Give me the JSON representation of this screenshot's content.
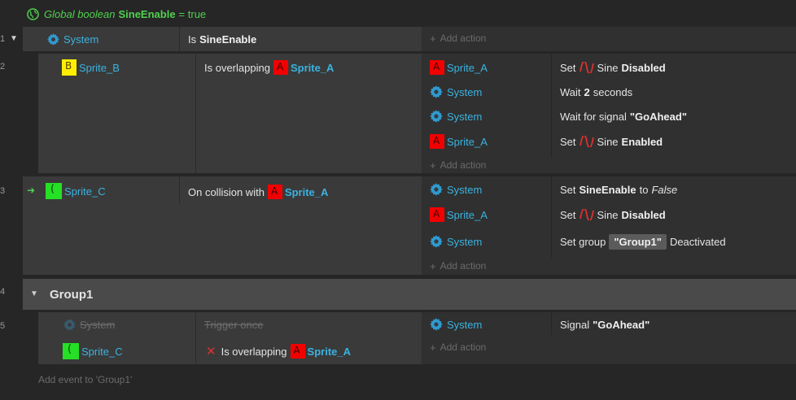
{
  "global_var": {
    "prefix": "Global boolean",
    "name": "SineEnable",
    "suffix": "= true"
  },
  "row_numbers": [
    "1",
    "2",
    "3",
    "4",
    "5"
  ],
  "event1": {
    "condition_object": "System",
    "condition_text_prefix": "Is",
    "condition_var": "SineEnable",
    "add_action": "Add action"
  },
  "event2": {
    "condition_object": "Sprite_B",
    "condition_text": "Is overlapping",
    "condition_target": "Sprite_A",
    "actions": [
      {
        "object": "Sprite_A",
        "verb": "Set",
        "behavior": "Sine",
        "state": "Disabled"
      },
      {
        "object": "System",
        "prefix": "Wait",
        "value": "2",
        "suffix": "seconds"
      },
      {
        "object": "System",
        "prefix": "Wait for signal",
        "value": "\"GoAhead\""
      },
      {
        "object": "Sprite_A",
        "verb": "Set",
        "behavior": "Sine",
        "state": "Enabled"
      }
    ],
    "add_action": "Add action"
  },
  "event3": {
    "trigger_arrow": "➜",
    "condition_object": "Sprite_C",
    "condition_text": "On collision with",
    "condition_target": "Sprite_A",
    "actions": [
      {
        "object": "System",
        "verb": "Set",
        "var": "SineEnable",
        "to": "to",
        "value": "False"
      },
      {
        "object": "Sprite_A",
        "verb": "Set",
        "behavior": "Sine",
        "state": "Disabled"
      },
      {
        "object": "System",
        "prefix": "Set group",
        "group": "\"Group1\"",
        "suffix": "Deactivated"
      }
    ],
    "add_action": "Add action"
  },
  "group": {
    "name": "Group1"
  },
  "event5": {
    "condition1_object": "System",
    "condition1_text": "Trigger once",
    "condition2_object": "Sprite_C",
    "condition2_invert": "✕",
    "condition2_text": "Is overlapping",
    "condition2_target": "Sprite_A",
    "actions": [
      {
        "object": "System",
        "prefix": "Signal",
        "value": "\"GoAhead\""
      }
    ],
    "add_action": "Add action"
  },
  "add_event": "Add event to 'Group1'",
  "colors": {
    "background": "#262626",
    "event_panel": "#3a3a3a",
    "object_link": "#3ab3e0",
    "global_var": "#4fd14f",
    "sine_icon": "#e03030"
  }
}
